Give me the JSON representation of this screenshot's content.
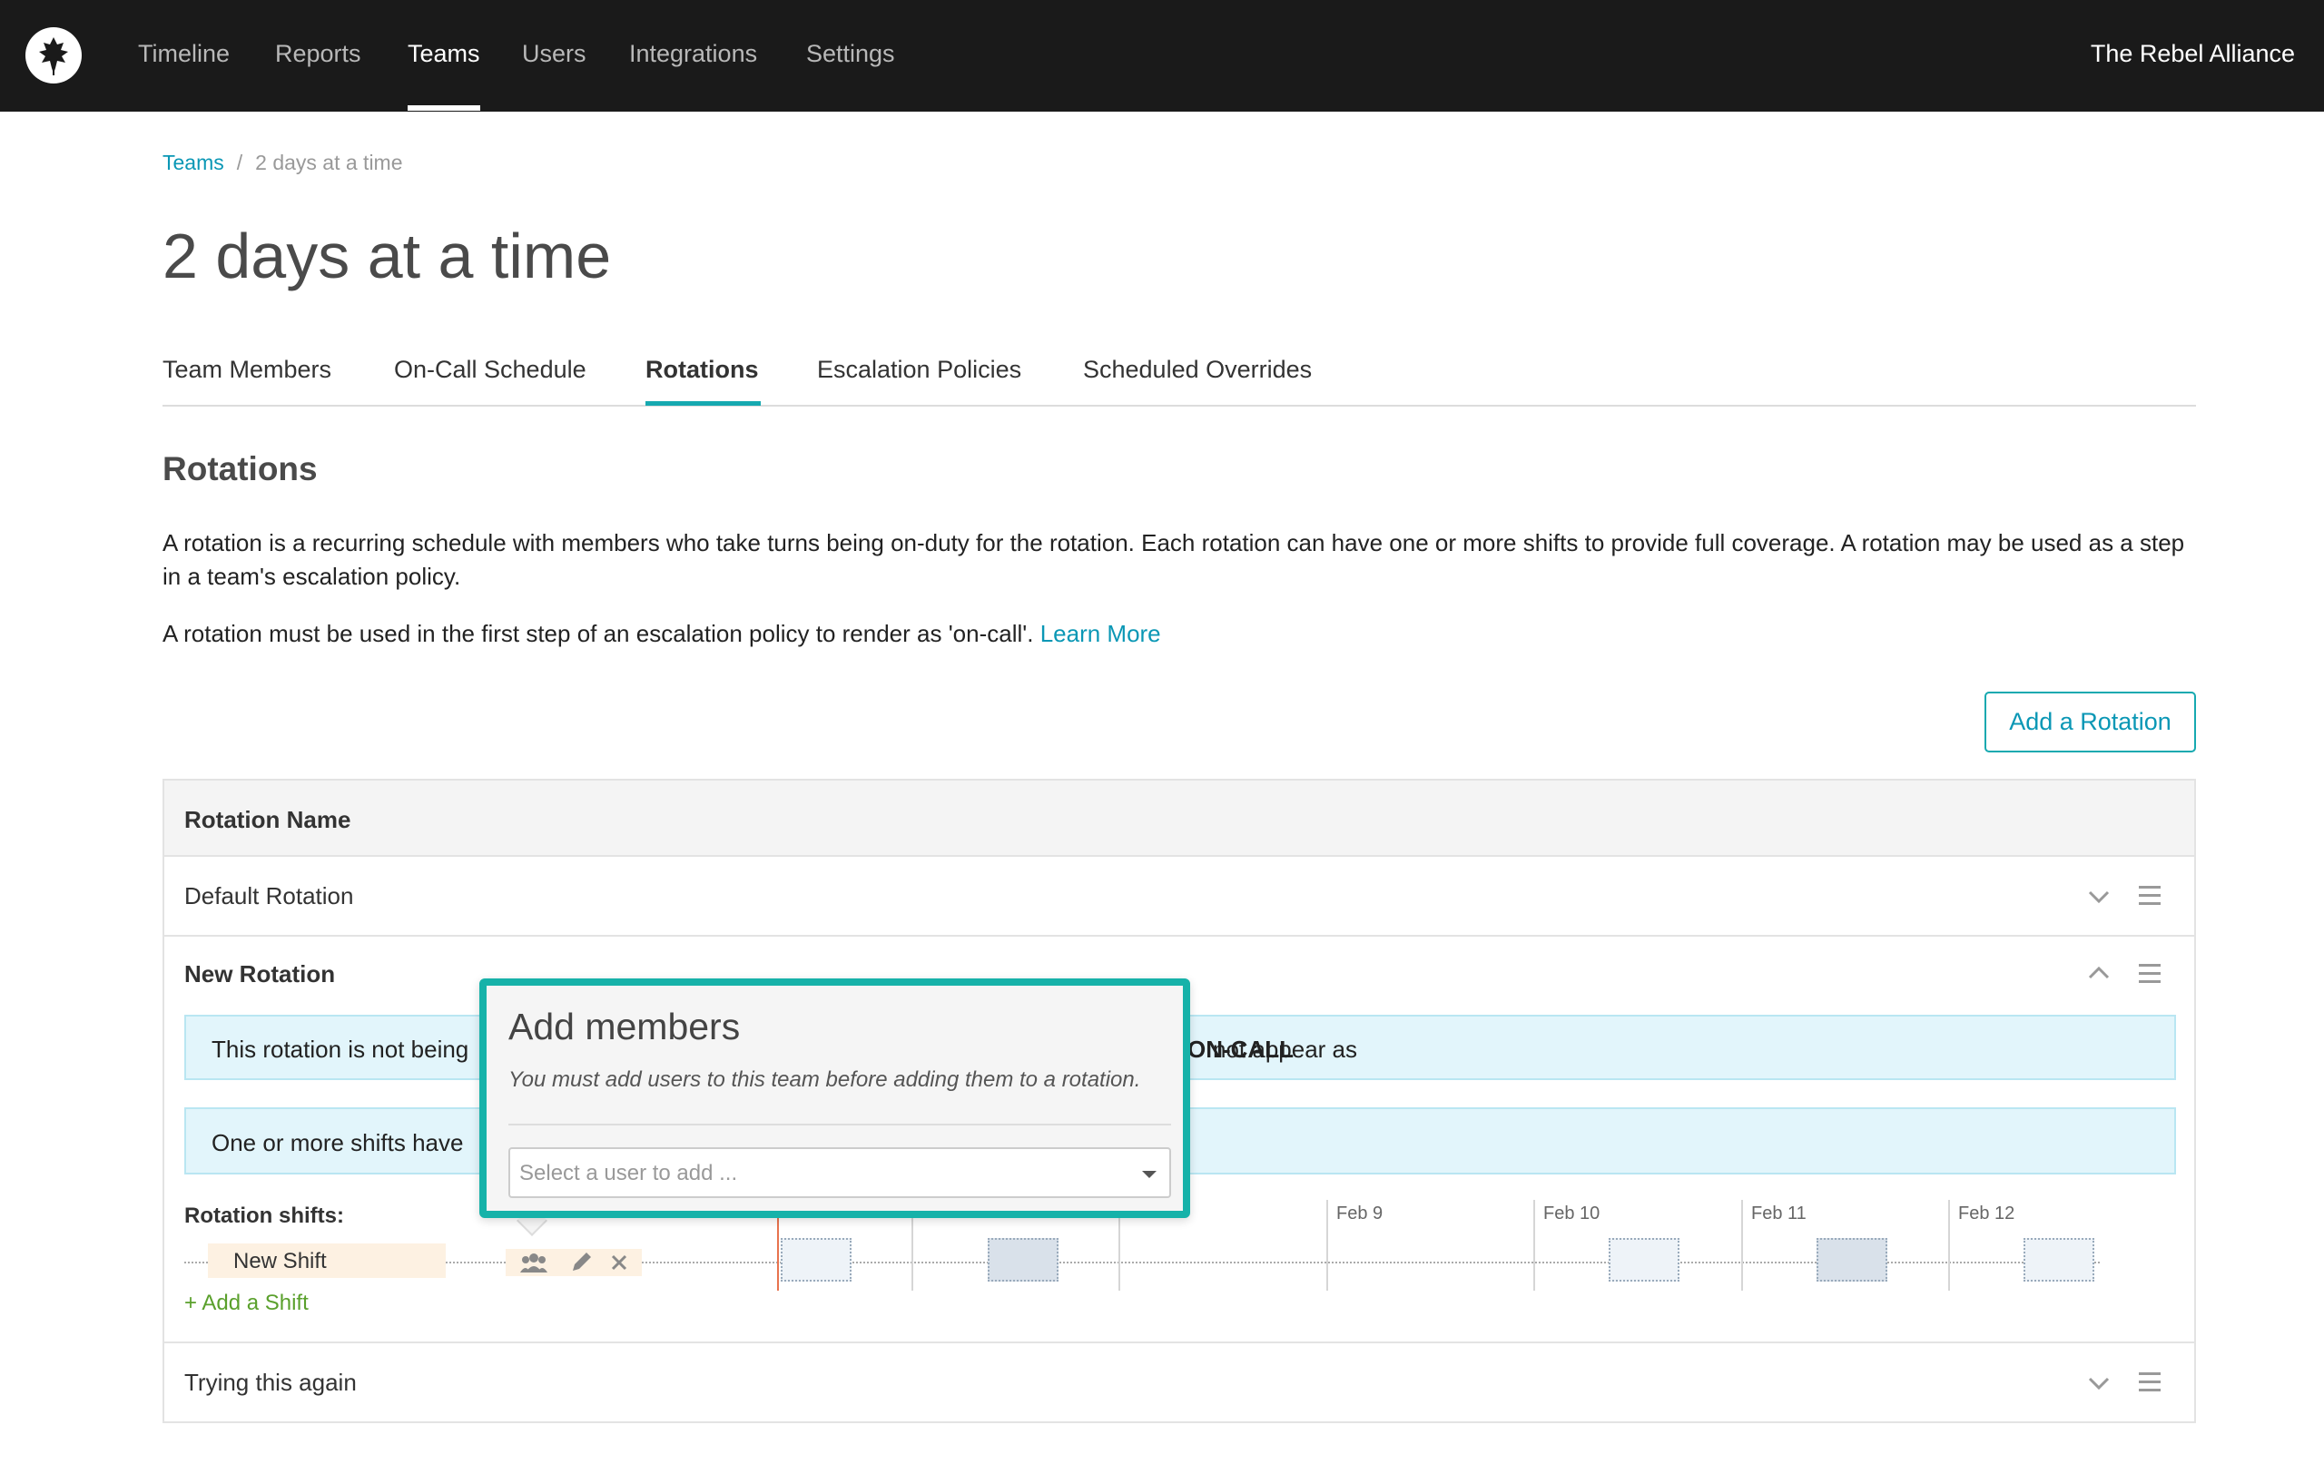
{
  "nav": {
    "items": [
      {
        "label": "Timeline",
        "active": false
      },
      {
        "label": "Reports",
        "active": false
      },
      {
        "label": "Teams",
        "active": true
      },
      {
        "label": "Users",
        "active": false
      },
      {
        "label": "Integrations",
        "active": false
      },
      {
        "label": "Settings",
        "active": false
      }
    ],
    "org_name": "The Rebel Alliance",
    "logo_icon": "leaf-logo-icon"
  },
  "breadcrumb": {
    "root": "Teams",
    "separator": "/",
    "current": "2 days at a time"
  },
  "page": {
    "title": "2 days at a time"
  },
  "tabs": [
    {
      "label": "Team Members",
      "active": false
    },
    {
      "label": "On-Call Schedule",
      "active": false
    },
    {
      "label": "Rotations",
      "active": true
    },
    {
      "label": "Escalation Policies",
      "active": false
    },
    {
      "label": "Scheduled Overrides",
      "active": false
    }
  ],
  "rotations_section": {
    "title": "Rotations",
    "description": "A rotation is a recurring schedule with members who take turns being on-duty for the rotation. Each rotation can have one or more shifts to provide full coverage. A rotation may be used as a step in a team's escalation policy.",
    "note_prefix": "A rotation must be used in the first step of an escalation policy to render as 'on-call'.",
    "note_link": "Learn More",
    "add_button": "Add a Rotation"
  },
  "table": {
    "header": "Rotation Name",
    "rows": [
      {
        "name": "Default Rotation",
        "expanded": false
      },
      {
        "name": "New Rotation",
        "expanded": true
      },
      {
        "name": "Trying this again",
        "expanded": false
      }
    ]
  },
  "expanded_rotation": {
    "alert1_left": "This rotation is not being",
    "alert1_right": "not appear as",
    "alert1_bold": "ON-CALL",
    "alert1_end": ".",
    "alert2_left": "One or more shifts have",
    "shifts_label": "Rotation shifts:",
    "shift_name": "New Shift",
    "add_shift": "+ Add a Shift",
    "day_labels": [
      "Feb 9",
      "Feb 10",
      "Feb 11",
      "Feb 12"
    ]
  },
  "popover": {
    "title": "Add members",
    "note": "You must add users to this team before adding them to a rotation.",
    "select_placeholder": "Select a user to add ..."
  },
  "colors": {
    "accent": "#16a9b0",
    "link": "#0a97b5",
    "nav_bg": "#1a1a1a",
    "alert_bg": "#e2f5fb",
    "add_shift": "#5aa02c",
    "today_line": "#e8734e"
  }
}
